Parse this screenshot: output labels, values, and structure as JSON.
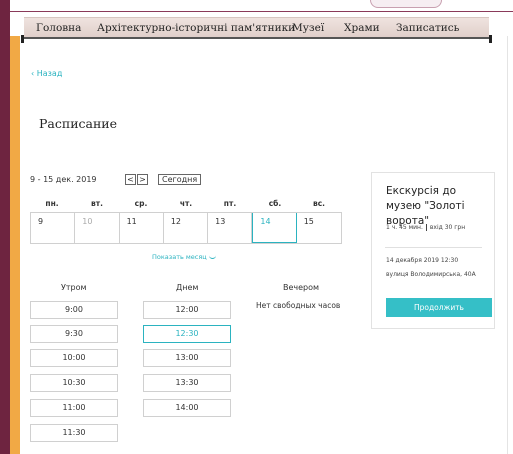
{
  "nav": {
    "items": [
      "Головна",
      "Архітектурно-історичні пам'ятники",
      "Музеї",
      "Храми",
      "Записатись"
    ]
  },
  "back_label": "Назад",
  "page_title": "Расписание",
  "calendar": {
    "range_label": "9 - 15 дек. 2019",
    "prev_icon": "<",
    "next_icon": ">",
    "today_label": "Сегодня",
    "weekdays": [
      "пн.",
      "вт.",
      "ср.",
      "чт.",
      "пт.",
      "сб.",
      "вс."
    ],
    "days": [
      "9",
      "10",
      "11",
      "12",
      "13",
      "14",
      "15"
    ],
    "muted_day": "10",
    "selected_day": "14",
    "show_month_label": "Показать месяц"
  },
  "schedule": {
    "morning": {
      "label": "Утром",
      "slots": [
        "9:00",
        "9:30",
        "10:00",
        "10:30",
        "11:00",
        "11:30"
      ]
    },
    "day": {
      "label": "Днем",
      "slots": [
        "12:00",
        "12:30",
        "13:00",
        "13:30",
        "14:00"
      ],
      "selected": "12:30"
    },
    "evening": {
      "label": "Вечером",
      "empty_text": "Нет свободных часов"
    }
  },
  "booking": {
    "title": "Екскурсія до музею \"Золоті ворота\"",
    "duration": "1 ч. 45 мин.",
    "price": "вхід 30 грн",
    "datetime": "14 декабря 2019 12:30",
    "address": "вулиця Володимирська, 40А",
    "continue_label": "Продолжить"
  },
  "colors": {
    "accent": "#2bb3c0",
    "button": "#35bfc7",
    "frame": "#6e2440",
    "side_accent": "#f1a945",
    "nav_bg": "#e8d9d4"
  }
}
